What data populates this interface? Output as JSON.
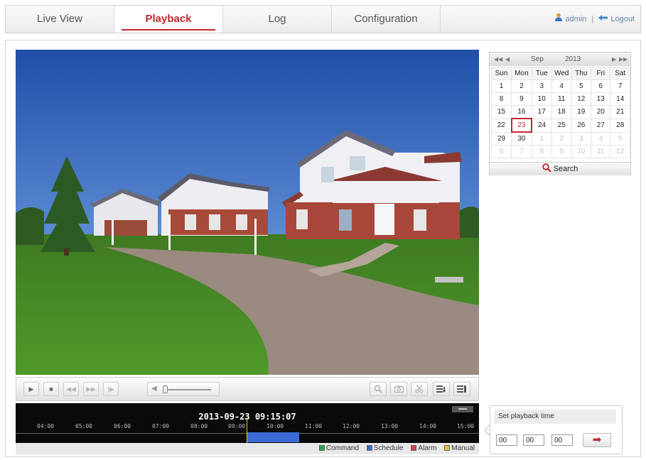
{
  "nav": {
    "tabs": [
      {
        "label": "Live View"
      },
      {
        "label": "Playback"
      },
      {
        "label": "Log"
      },
      {
        "label": "Configuration"
      }
    ],
    "active_tab": "Playback",
    "user": "admin",
    "separator": "|",
    "logout": "Logout"
  },
  "calendar": {
    "month": "Sep",
    "year": "2013",
    "weekdays": [
      "Sun",
      "Mon",
      "Tue",
      "Wed",
      "Thu",
      "Fri",
      "Sat"
    ],
    "weeks": [
      [
        "1",
        "2",
        "3",
        "4",
        "5",
        "6",
        "7"
      ],
      [
        "8",
        "9",
        "10",
        "11",
        "12",
        "13",
        "14"
      ],
      [
        "15",
        "16",
        "17",
        "18",
        "19",
        "20",
        "21"
      ],
      [
        "22",
        "23",
        "24",
        "25",
        "26",
        "27",
        "28"
      ],
      [
        "29",
        "30",
        "1",
        "2",
        "3",
        "4",
        "5"
      ],
      [
        "6",
        "7",
        "8",
        "9",
        "10",
        "11",
        "12"
      ]
    ],
    "selected_day": "23",
    "search_label": "Search"
  },
  "timeline": {
    "datetime": "2013-09-23 09:15:07",
    "ticks": [
      "04:00",
      "05:00",
      "06:00",
      "07:00",
      "08:00",
      "09:00",
      "10:00",
      "11:00",
      "12:00",
      "13:00",
      "14:00",
      "15:00"
    ],
    "legend": [
      {
        "label": "Command",
        "color": "#22a35a"
      },
      {
        "label": "Schedule",
        "color": "#3b6ad6"
      },
      {
        "label": "Alarm",
        "color": "#d63b4a"
      },
      {
        "label": "Manual",
        "color": "#e6c22a"
      }
    ]
  },
  "playback_time": {
    "title": "Set playback time",
    "hour": "00",
    "minute": "00",
    "second": "00"
  },
  "colors": {
    "accent": "#c0282e",
    "record_bar": "#3b6ad6"
  }
}
